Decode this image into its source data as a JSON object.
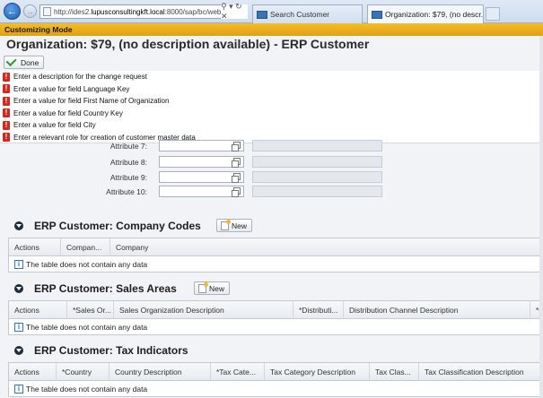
{
  "browser": {
    "url_prefix": "http://ides2.",
    "url_host": "lupusconsultingkft.local",
    "url_rest": ":8000/sap/bc/web",
    "url_controls": "⚲ ▾ ↻ ✕",
    "tabs": [
      {
        "label": "Search Customer",
        "active": false
      },
      {
        "label": "Organization: $79, (no descr...",
        "active": true
      }
    ],
    "tab_close": "×"
  },
  "mode_bar": "Customizing Mode",
  "page_title": "Organization: $79, (no description available) - ERP Customer",
  "toolbar": {
    "done_label": "Done"
  },
  "messages": [
    "Enter a description for the change request",
    "Enter a value for field Language Key",
    "Enter a value for field First Name of Organization",
    "Enter a value for field Country Key",
    "Enter a value for field City",
    "Enter a relevant role for creation of customer master data"
  ],
  "error_glyph": "!",
  "attributes": [
    {
      "label": "Attribute 7:",
      "value": ""
    },
    {
      "label": "Attribute 8:",
      "value": ""
    },
    {
      "label": "Attribute 9:",
      "value": ""
    },
    {
      "label": "Attribute 10:",
      "value": ""
    }
  ],
  "sections": {
    "company_codes": {
      "title": "ERP Customer: Company Codes",
      "new_label": "New",
      "columns": [
        "Actions",
        "Compan...",
        "Company"
      ],
      "empty_text": "The table does not contain any data"
    },
    "sales_areas": {
      "title": "ERP Customer: Sales Areas",
      "new_label": "New",
      "columns": [
        "Actions",
        "*Sales Or...",
        "Sales Organization Description",
        "*Distributi...",
        "Distribution Channel Description",
        "*Div"
      ],
      "empty_text": "The table does not contain any data"
    },
    "tax_indicators": {
      "title": "ERP Customer: Tax Indicators",
      "columns": [
        "Actions",
        "*Country",
        "Country Description",
        "*Tax Cate...",
        "Tax Category Description",
        "Tax Clas...",
        "Tax Classification Description"
      ],
      "empty_text": "The table does not contain any data"
    }
  },
  "info_glyph": "i",
  "colors": {
    "mode_bar": "#e8ad1e",
    "error": "#d9261c",
    "accent": "#3274c0"
  }
}
